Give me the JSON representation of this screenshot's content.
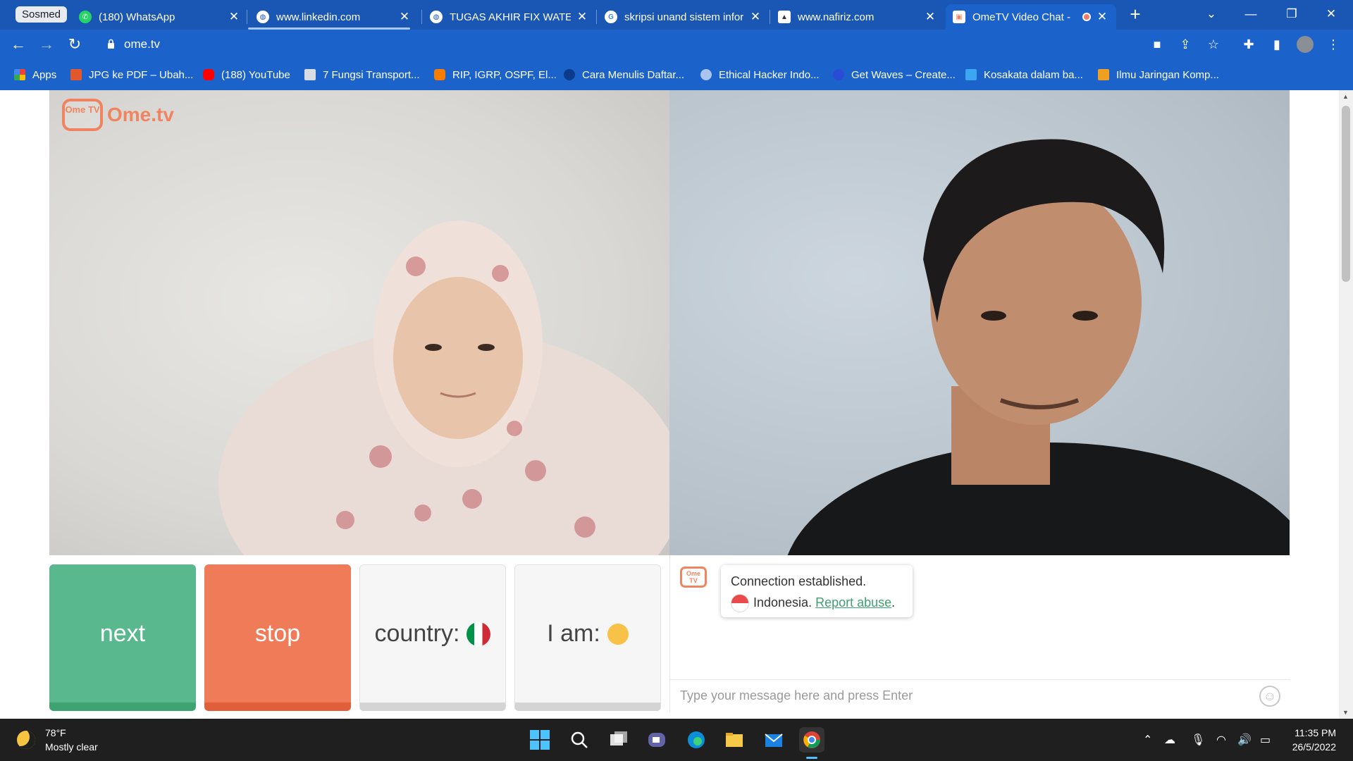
{
  "browser": {
    "group_chip": "Sosmed",
    "tabs": [
      {
        "label": "(180) WhatsApp",
        "icon": "whatsapp-icon"
      },
      {
        "label": "www.linkedin.com",
        "icon": "globe-icon"
      },
      {
        "label": "TUGAS AKHIR FIX WATER",
        "icon": "globe-icon"
      },
      {
        "label": "skripsi unand sistem infor",
        "icon": "google-icon"
      },
      {
        "label": "www.nafiriz.com",
        "icon": "page-icon"
      },
      {
        "label": "OmeTV Video Chat -",
        "icon": "ometv-icon"
      }
    ],
    "url": "ome.tv",
    "bookmarks": [
      {
        "label": "Apps",
        "icon": "apps-grid-icon"
      },
      {
        "label": "JPG ke PDF – Ubah...",
        "icon": "jpg-pdf-icon"
      },
      {
        "label": "(188) YouTube",
        "icon": "youtube-icon"
      },
      {
        "label": "7 Fungsi Transport...",
        "icon": "page-icon"
      },
      {
        "label": "RIP, IGRP, OSPF, El...",
        "icon": "blogger-icon"
      },
      {
        "label": "Cara Menulis Daftar...",
        "icon": "site-icon"
      },
      {
        "label": "Ethical Hacker Indo...",
        "icon": "site-icon"
      },
      {
        "label": "Get Waves – Create...",
        "icon": "site-icon"
      },
      {
        "label": "Kosakata dalam ba...",
        "icon": "site-icon"
      },
      {
        "label": "Ilmu Jaringan Komp...",
        "icon": "site-icon"
      }
    ]
  },
  "ometv": {
    "logo_tv": "Ome TV",
    "logo_word": "Ome.tv",
    "buttons": {
      "next": "next",
      "stop": "stop",
      "country": "country:",
      "iam": "I am:"
    },
    "chat": {
      "status": "Connection established.",
      "country": "Indonesia.",
      "report": "Report abuse",
      "report_suffix": ".",
      "input_placeholder": "Type your message here and press Enter"
    },
    "colors": {
      "next": "#5ab88f",
      "stop": "#ef7b58",
      "brand": "#f08461"
    }
  },
  "taskbar": {
    "temperature": "78°F",
    "weather": "Mostly clear",
    "time": "11:35 PM",
    "date": "26/5/2022"
  }
}
